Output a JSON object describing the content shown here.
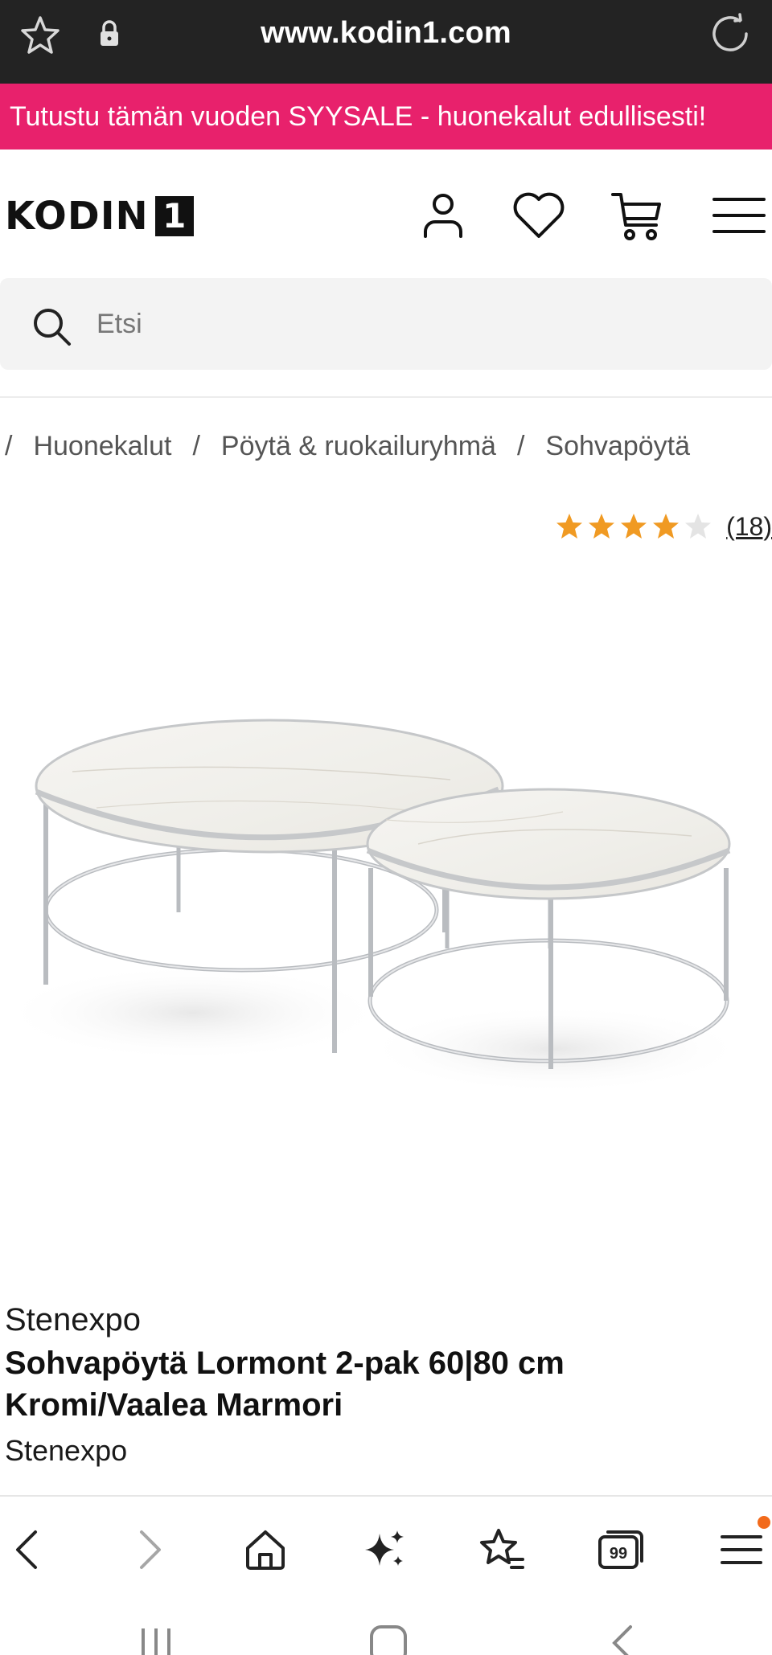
{
  "browser": {
    "url": "www.kodin1.com",
    "icons": [
      "star-outline-icon",
      "lock-icon",
      "reload-icon"
    ]
  },
  "promo": {
    "text": "Tutustu tämän vuoden SYYSALE - huonekalut edullisesti!",
    "background": "#e8216c"
  },
  "header": {
    "logo_text": "KODIN",
    "logo_number": "1",
    "icons": [
      "account-icon",
      "wishlist-heart-icon",
      "cart-icon",
      "menu-icon"
    ]
  },
  "search": {
    "placeholder": "Etsi"
  },
  "breadcrumb": {
    "items": [
      "Huonekalut",
      "Pöytä & ruokailuryhmä",
      "Sohvapöytä"
    ]
  },
  "rating": {
    "stars": 4,
    "max_stars": 5,
    "count": "(18)",
    "star_color": "#f09a23"
  },
  "product": {
    "brand_top": "Stenexpo",
    "title": "Sohvapöytä Lormont 2-pak 60|80 cm Kromi/Vaalea Marmori",
    "brand_bottom": "Stenexpo"
  },
  "toolbar": {
    "icons": [
      "back-icon",
      "forward-icon",
      "home-icon",
      "ai-sparkle-icon",
      "bookmarks-icon",
      "tabs-icon",
      "menu-icon"
    ],
    "tabs_count": "99",
    "notification_color": "#f26a1b"
  }
}
